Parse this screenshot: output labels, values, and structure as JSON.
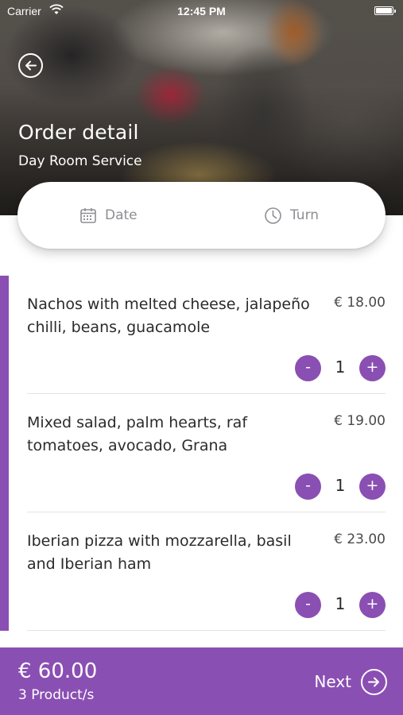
{
  "status_bar": {
    "carrier": "Carrier",
    "time": "12:45 PM"
  },
  "header": {
    "title": "Order detail",
    "subtitle": "Day Room Service",
    "back_icon": "arrow-left-circle-icon"
  },
  "selector": {
    "date_label": "Date",
    "date_icon": "calendar-icon",
    "turn_label": "Turn",
    "turn_icon": "clock-icon"
  },
  "items": [
    {
      "name": "Nachos with melted cheese, jalapeño chilli, beans, guacamole",
      "price": "€ 18.00",
      "quantity": "1"
    },
    {
      "name": "Mixed salad, palm hearts, raf tomatoes, avocado, Grana",
      "price": "€ 19.00",
      "quantity": "1"
    },
    {
      "name": "Iberian pizza with mozzarella, basil and Iberian ham",
      "price": "€ 23.00",
      "quantity": "1"
    }
  ],
  "qty_controls": {
    "minus": "-",
    "plus": "+"
  },
  "footer": {
    "total": "€ 60.00",
    "count": "3 Product/s",
    "next_label": "Next",
    "next_icon": "arrow-right-circle-icon"
  },
  "colors": {
    "accent": "#8a4fb3",
    "muted": "#8e8e93"
  }
}
